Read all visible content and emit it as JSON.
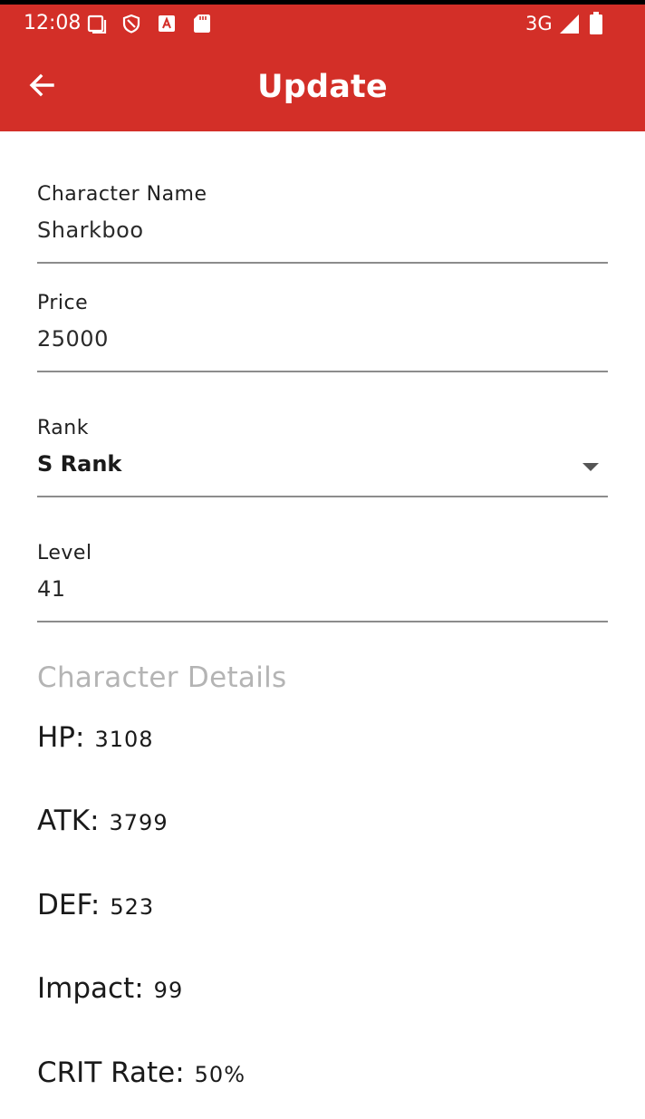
{
  "status_bar": {
    "time": "12:08",
    "network": "3G",
    "color": "#d32f28",
    "icons": [
      "screen-icon",
      "shield-icon",
      "a-icon",
      "sd-card-icon",
      "signal-icon",
      "battery-icon"
    ]
  },
  "app_bar": {
    "title": "Update",
    "back_icon": "arrow-back-icon",
    "color": "#d32f28"
  },
  "form": {
    "name": {
      "label": "Character Name",
      "value": "Sharkboo"
    },
    "price": {
      "label": "Price",
      "value": "25000"
    },
    "rank": {
      "label": "Rank",
      "selected": "S Rank"
    },
    "level": {
      "label": "Level",
      "value": "41"
    }
  },
  "details": {
    "heading": "Character Details",
    "stats": [
      {
        "label": "HP:",
        "value": "3108"
      },
      {
        "label": "ATK:",
        "value": "3799"
      },
      {
        "label": "DEF:",
        "value": "523"
      },
      {
        "label": "Impact:",
        "value": "99"
      },
      {
        "label": "CRIT Rate:",
        "value": "50%"
      }
    ]
  }
}
